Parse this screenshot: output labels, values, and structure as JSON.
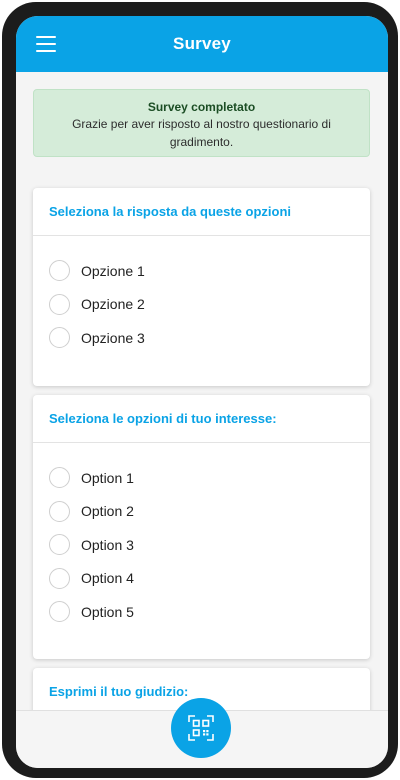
{
  "appbar": {
    "title": "Survey",
    "menu_icon": "hamburger-menu-icon"
  },
  "alert": {
    "title": "Survey completato",
    "text": "Grazie per aver risposto al nostro questionario di gradimento.",
    "color": "#d5ecd9"
  },
  "card1": {
    "title": "Seleziona la risposta da queste opzioni",
    "options": [
      "Opzione 1",
      "Opzione 2",
      "Opzione 3"
    ]
  },
  "card2": {
    "title": "Seleziona le opzioni di tuo interesse:",
    "options": [
      "Option 1",
      "Option 2",
      "Option 3",
      "Option 4",
      "Option 5"
    ]
  },
  "card3": {
    "title": "Esprimi il tuo giudizio:"
  },
  "fab": {
    "icon": "qr-code-scan-icon"
  },
  "colors": {
    "accent": "#0aa3e6"
  }
}
